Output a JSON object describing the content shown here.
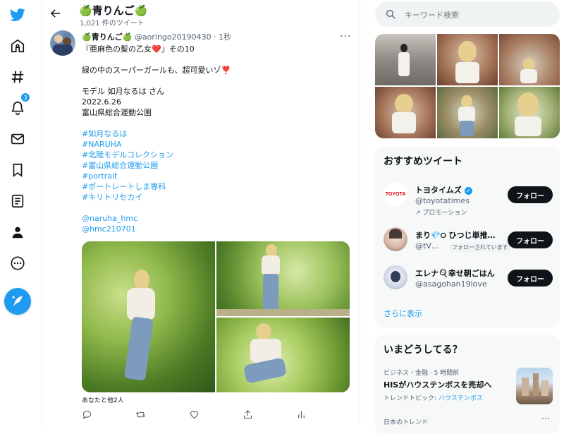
{
  "header": {
    "name": "🍏青りんご🍏",
    "tweet_count": "1,021 件のツイート"
  },
  "tweet": {
    "display_name": "🍏青りんご🍏",
    "handle": "@aoringo20190430",
    "time": "· 1秒",
    "lines": [
      "『亜麻色の髪の乙女❤️』その10",
      "",
      "緑の中のスーパーガールも、超可愛いゾ❣️",
      "",
      "モデル 如月なるは さん",
      "2022.6.26",
      "富山県総合運動公園"
    ],
    "hashtags": [
      "#如月なるは",
      "#NARUHA",
      "#北陸モデルコレクション",
      "#富山県総合運動公園",
      "#portrait",
      "#ポートレートしま専科",
      "#キリトリセカイ"
    ],
    "mentions": [
      "@naruha_hmc",
      "@hmc210701"
    ],
    "liked_by": "あなたと他2人"
  },
  "nav": {
    "notification_count": "3"
  },
  "search": {
    "placeholder": "キーワード検索"
  },
  "recommend": {
    "title": "おすすめツイート",
    "show_more": "さらに表示",
    "follow_label": "フォロー",
    "accounts": [
      {
        "name": "トヨタイムズ",
        "handle": "@toyotatimes",
        "promo": "プロモーション"
      },
      {
        "name": "まり💎୦ ひつじ単推…",
        "handle": "@tV…",
        "follows_you": "フォローされています"
      },
      {
        "name": "エレナ🍳幸せ朝ごはん",
        "handle": "@asagohan19love"
      }
    ],
    "toyota_logo_text": "TOYOTA"
  },
  "trends": {
    "title": "いまどうしてる？",
    "item_meta": "ビジネス・金融 · 5 時間前",
    "item_title": "HISがハウステンボスを売却へ",
    "topic_label": "トレンドトピック:",
    "topic_name": "ハウステンボス",
    "next_label": "日本のトレンド"
  },
  "colors": {
    "accent": "#1d9bf0",
    "text": "#0f1419",
    "muted": "#536471",
    "card_bg": "#f7f9f9"
  }
}
